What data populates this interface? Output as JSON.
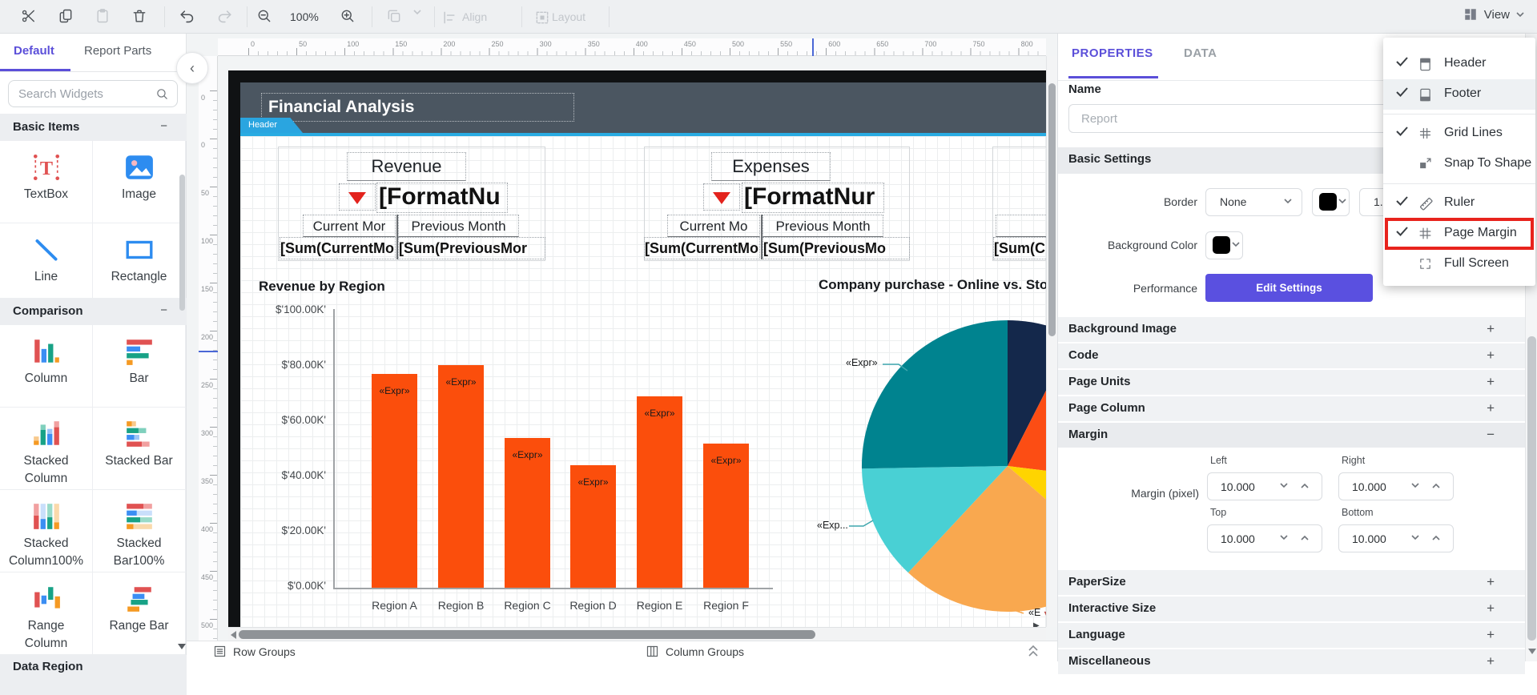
{
  "toolbar": {
    "zoom_level": "100%",
    "align_label": "Align",
    "layout_label": "Layout",
    "view_label": "View",
    "buttons": [
      {
        "name": "cut",
        "disabled": false
      },
      {
        "name": "copy",
        "disabled": false
      },
      {
        "name": "paste",
        "disabled": true
      },
      {
        "name": "delete",
        "disabled": false
      },
      {
        "name": "undo",
        "disabled": false
      },
      {
        "name": "redo",
        "disabled": true
      },
      {
        "name": "zoom-out",
        "disabled": false
      },
      {
        "name": "zoom-in",
        "disabled": false
      },
      {
        "name": "duplicate",
        "disabled": true
      }
    ]
  },
  "sidebar": {
    "tabs": [
      {
        "label": "Default",
        "active": true
      },
      {
        "label": "Report Parts",
        "active": false
      }
    ],
    "search_placeholder": "Search Widgets",
    "sections": [
      {
        "title": "Basic Items",
        "items": [
          {
            "label": "TextBox",
            "icon": "textbox-icon"
          },
          {
            "label": "Image",
            "icon": "image-icon"
          },
          {
            "label": "Line",
            "icon": "line-icon"
          },
          {
            "label": "Rectangle",
            "icon": "rectangle-icon"
          }
        ]
      },
      {
        "title": "Comparison",
        "items": [
          {
            "label": "Column",
            "icon": "column-icon"
          },
          {
            "label": "Bar",
            "icon": "bar-icon"
          },
          {
            "label": "Stacked Column",
            "icon": "stacked-column-icon"
          },
          {
            "label": "Stacked Bar",
            "icon": "stacked-bar-icon"
          },
          {
            "label": "Stacked Column100%",
            "icon": "stacked-column100-icon"
          },
          {
            "label": "Stacked Bar100%",
            "icon": "stacked-bar100-icon"
          },
          {
            "label": "Range Column",
            "icon": "range-column-icon"
          },
          {
            "label": "Range Bar",
            "icon": "range-bar-icon"
          }
        ]
      }
    ],
    "partial_section_title": "Data Region"
  },
  "canvas": {
    "h_ruler": [
      0,
      50,
      100,
      150,
      200,
      250,
      300,
      350,
      400,
      450,
      500,
      550,
      600,
      650,
      700,
      750,
      800
    ],
    "v_ruler": [
      0,
      50,
      100,
      150,
      200,
      250,
      300,
      350,
      400,
      450,
      500
    ],
    "v_ruler_header_zero": "0",
    "page": {
      "title": "Financial Analysis",
      "header_tab": "Header"
    },
    "revenue": {
      "title": "Revenue",
      "format": "[FormatNu",
      "current": "Current Mor",
      "previous": "Previous Month",
      "sum_current": "[Sum(CurrentMont",
      "sum_previous": "[Sum(PreviousMor"
    },
    "expenses": {
      "title": "Expenses",
      "format": "[FormatNur",
      "current": "Current Mo",
      "previous": "Previous Month",
      "sum_current": "[Sum(CurrentMon",
      "sum_previous": "[Sum(PreviousMo"
    },
    "third_block": {
      "sum": "[Sum(C"
    },
    "pie_labels": {
      "top": "«Expr»",
      "left": "«Exp...",
      "corner": "«E"
    },
    "status": {
      "row_groups": "Row Groups",
      "column_groups": "Column Groups"
    }
  },
  "chart_data": [
    {
      "type": "bar",
      "title": "Revenue by Region",
      "categories": [
        "Region A",
        "Region B",
        "Region C",
        "Region D",
        "Region E",
        "Region F"
      ],
      "values": [
        77,
        80,
        54,
        44,
        69,
        52
      ],
      "unit": "thousand USD",
      "ylim": [
        0,
        100
      ],
      "y_ticks": [
        "$'100.00K'",
        "$'80.00K'",
        "$'60.00K'",
        "$'40.00K'",
        "$'20.00K'",
        "$'0.00K'"
      ],
      "bar_color": "#fb4e0c",
      "bar_label": "«Expr»",
      "grid": true,
      "legend": false
    },
    {
      "type": "pie",
      "title": "Company purchase - Online vs. Sto",
      "note": "angles in degrees clockwise from 12 o'clock; pie clipped at right by panel edge",
      "slices": [
        {
          "name": "navy",
          "start": 0,
          "end": 27,
          "color": "#14284b"
        },
        {
          "name": "orange-red",
          "start": 27,
          "end": 97,
          "color": "#fc4d14"
        },
        {
          "name": "yellow",
          "start": 97,
          "end": 131,
          "color": "#ffd400"
        },
        {
          "name": "light-orange",
          "start": 131,
          "end": 223,
          "color": "#f9a84f"
        },
        {
          "name": "cyan",
          "start": 223,
          "end": 269,
          "color": "#49d0d4"
        },
        {
          "name": "teal",
          "start": 269,
          "end": 360,
          "color": "#00838f"
        }
      ],
      "data_labels": [
        "«Expr»",
        "«Exp..."
      ],
      "legend": false
    }
  ],
  "properties": {
    "tabs": [
      {
        "label": "PROPERTIES",
        "active": true
      },
      {
        "label": "DATA",
        "active": false
      }
    ],
    "name_label": "Name",
    "name_placeholder": "Report",
    "basic_settings_title": "Basic Settings",
    "border_label": "Border",
    "border_value": "None",
    "border_color": "#000000",
    "border_width": "1.",
    "background_color_label": "Background Color",
    "background_color": "#000000",
    "performance_label": "Performance",
    "edit_settings_label": "Edit Settings",
    "accordions_top": [
      "Background Image",
      "Code",
      "Page Units",
      "Page Column"
    ],
    "margin_title": "Margin",
    "margin_label": "Margin (pixel)",
    "margin_fields": [
      {
        "label": "Left",
        "value": "10.000"
      },
      {
        "label": "Right",
        "value": "10.000"
      },
      {
        "label": "Top",
        "value": "10.000"
      },
      {
        "label": "Bottom",
        "value": "10.000"
      }
    ],
    "accordions_bottom": [
      "PaperSize",
      "Interactive Size",
      "Language",
      "Miscellaneous"
    ],
    "accent_color": "#5b4fd9"
  },
  "view_menu": {
    "items": [
      {
        "label": "Header",
        "icon": "header-icon",
        "checked": true
      },
      {
        "label": "Footer",
        "icon": "footer-icon",
        "checked": true,
        "hover": true
      },
      {
        "divider": true
      },
      {
        "label": "Grid Lines",
        "icon": "grid-lines-icon",
        "checked": true
      },
      {
        "label": "Snap To Shape",
        "icon": "snap-to-shape-icon",
        "checked": false
      },
      {
        "divider": true
      },
      {
        "label": "Ruler",
        "icon": "ruler-icon",
        "checked": true
      },
      {
        "label": "Page Margin",
        "icon": "page-margin-icon",
        "checked": true,
        "highlighted": true
      },
      {
        "label": "Full Screen",
        "icon": "full-screen-icon",
        "checked": false
      }
    ],
    "highlight_color": "#e8231d"
  }
}
